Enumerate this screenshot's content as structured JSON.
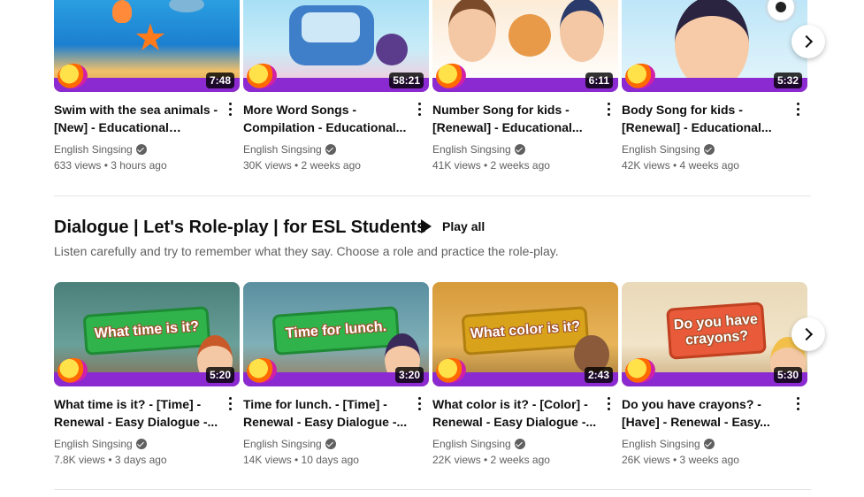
{
  "shelf1": {
    "videos": [
      {
        "title": "Swim with the sea animals - [New] - Educational Children...",
        "channel": "English Singsing",
        "stats": "633 views • 3 hours ago",
        "duration": "7:48"
      },
      {
        "title": "More Word Songs - Compilation - Educational...",
        "channel": "English Singsing",
        "stats": "30K views • 2 weeks ago",
        "duration": "58:21"
      },
      {
        "title": "Number Song for kids - [Renewal] - Educational...",
        "channel": "English Singsing",
        "stats": "41K views • 2 weeks ago",
        "duration": "6:11"
      },
      {
        "title": "Body Song for kids - [Renewal] - Educational...",
        "channel": "English Singsing",
        "stats": "42K views • 4 weeks ago",
        "duration": "5:32"
      }
    ]
  },
  "shelf2": {
    "title": "Dialogue | Let's Role-play | for ESL Students",
    "play_all": "Play all",
    "description": "Listen carefully and try to remember what they say. Choose a role and practice the role-play.",
    "videos": [
      {
        "title": "What time is it? - [Time] - Renewal - Easy Dialogue -...",
        "channel": "English Singsing",
        "stats": "7.8K views • 3 days ago",
        "duration": "5:20",
        "bubble": "What time is it?"
      },
      {
        "title": "Time for lunch. - [Time] - Renewal - Easy Dialogue -...",
        "channel": "English Singsing",
        "stats": "14K views • 10 days ago",
        "duration": "3:20",
        "bubble": "Time for lunch."
      },
      {
        "title": "What color is it? - [Color] - Renewal - Easy Dialogue -...",
        "channel": "English Singsing",
        "stats": "22K views • 2 weeks ago",
        "duration": "2:43",
        "bubble": "What color is it?"
      },
      {
        "title": "Do you have crayons? - [Have] - Renewal - Easy...",
        "channel": "English Singsing",
        "stats": "26K views • 3 weeks ago",
        "duration": "5:30",
        "bubble": "Do you have crayons?"
      }
    ]
  },
  "colors": {
    "accent": "#0f0f0f",
    "secondary_text": "#606060",
    "brand_band": "#8b2ad0"
  },
  "icons": {
    "next": "chevron-right-icon",
    "more": "more-vert-icon",
    "verified": "verified-check-icon",
    "play": "play-icon"
  }
}
